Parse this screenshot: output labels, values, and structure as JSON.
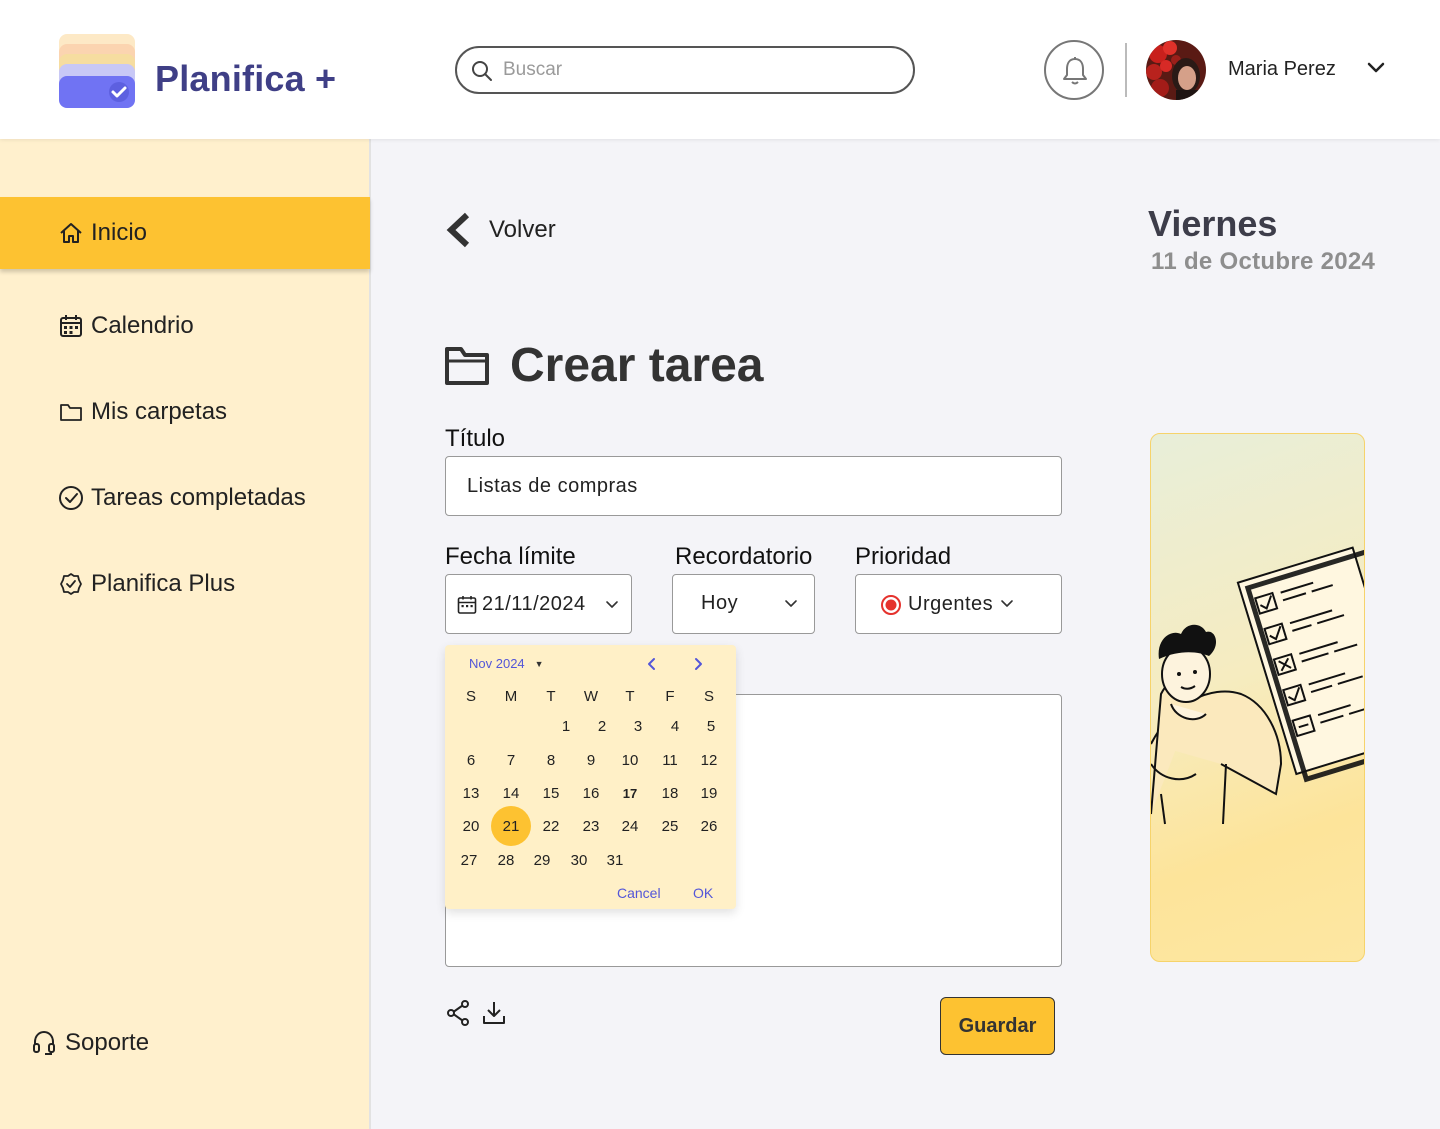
{
  "header": {
    "brand": "Planifica +",
    "search_placeholder": "Buscar",
    "user_name": "Maria Perez"
  },
  "sidebar": {
    "items": [
      {
        "label": "Inicio",
        "icon": "home-icon",
        "active": true
      },
      {
        "label": "Calendrio",
        "icon": "calendar-icon"
      },
      {
        "label": "Mis carpetas",
        "icon": "folder-icon"
      },
      {
        "label": "Tareas completadas",
        "icon": "check-circle-icon"
      },
      {
        "label": "Planifica Plus",
        "icon": "badge-check-icon"
      }
    ],
    "support": "Soporte"
  },
  "main": {
    "back": "Volver",
    "day_name": "Viernes",
    "date_text": "11 de Octubre 2024",
    "page_title": "Crear tarea",
    "form": {
      "title_label": "Título",
      "title_value": "Listas de compras",
      "due_label": "Fecha límite",
      "due_value": "21/11/2024",
      "reminder_label": "Recordatorio",
      "reminder_value": "Hoy",
      "priority_label": "Prioridad",
      "priority_value": "Urgentes",
      "priority_color": "#e5322d",
      "save": "Guardar"
    },
    "datepicker": {
      "month_label": "Nov 2024",
      "weekdays": [
        "S",
        "M",
        "T",
        "W",
        "T",
        "F",
        "S"
      ],
      "selected_day": 21,
      "today_day": 17,
      "days": [
        "1",
        "2",
        "3",
        "4",
        "5",
        "6",
        "7",
        "8",
        "9",
        "10",
        "11",
        "12",
        "13",
        "14",
        "15",
        "16",
        "17",
        "18",
        "19",
        "20",
        "21",
        "22",
        "23",
        "24",
        "25",
        "26",
        "27",
        "28",
        "29",
        "30",
        "31"
      ],
      "cancel": "Cancel",
      "ok": "OK"
    }
  },
  "colors": {
    "accent": "#fdc231",
    "sidebar_bg": "#fff0cd",
    "brand": "#3f3f86",
    "picker_link": "#5356d8"
  }
}
